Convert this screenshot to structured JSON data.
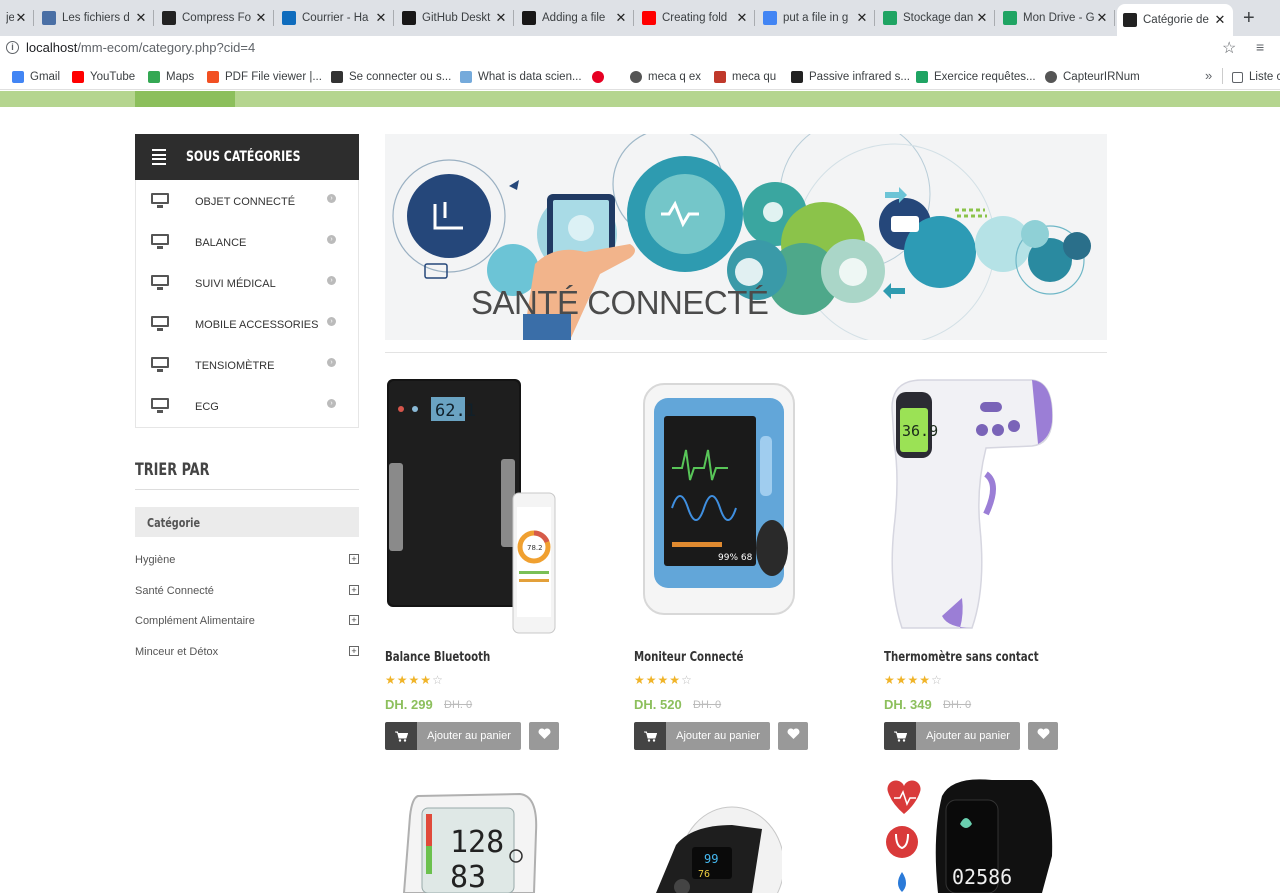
{
  "browser": {
    "tabs": [
      {
        "label": "je",
        "icon": "page-icon",
        "color": "#5f6368"
      },
      {
        "label": "Les fichiers d",
        "icon": "folder-icon",
        "color": "#4a6fa5"
      },
      {
        "label": "Compress Fo",
        "icon": "compress-icon",
        "color": "#222222"
      },
      {
        "label": "Courrier - Ha",
        "icon": "outlook-icon",
        "color": "#0f6cbd"
      },
      {
        "label": "GitHub Deskt",
        "icon": "github-icon",
        "color": "#181717"
      },
      {
        "label": "Adding a file",
        "icon": "github-icon",
        "color": "#181717"
      },
      {
        "label": "Creating fold",
        "icon": "youtube-icon",
        "color": "#ff0000"
      },
      {
        "label": "put a file in g",
        "icon": "google-icon",
        "color": "#4285f4"
      },
      {
        "label": "Stockage dan",
        "icon": "drive-icon",
        "color": "#1fa463"
      },
      {
        "label": "Mon Drive - G",
        "icon": "drive-icon",
        "color": "#1fa463"
      },
      {
        "label": "Catégorie de",
        "icon": "site-icon",
        "color": "#222222"
      }
    ],
    "url_host": "localhost",
    "url_path": "/mm-ecom/category.php?cid=4",
    "bookmarks": [
      {
        "label": "Gmail",
        "icon": "google-icon"
      },
      {
        "label": "YouTube",
        "icon": "youtube-icon"
      },
      {
        "label": "Maps",
        "icon": "maps-icon"
      },
      {
        "label": "PDF File viewer |...",
        "icon": "microsoft-icon"
      },
      {
        "label": "Se connecter ou s...",
        "icon": "bookmark-icon"
      },
      {
        "label": "What is data scien...",
        "icon": "rstudio-icon"
      },
      {
        "label": "",
        "icon": "pinterest-icon"
      },
      {
        "label": "meca q ex",
        "icon": "globe-icon"
      },
      {
        "label": "meca qu",
        "icon": "function-icon"
      },
      {
        "label": "Passive infrared s...",
        "icon": "wikipedia-icon"
      },
      {
        "label": "Exercice requêtes...",
        "icon": "classroom-icon"
      },
      {
        "label": "CapteurIRNum",
        "icon": "globe-icon"
      }
    ],
    "bookmarks_more": "»",
    "reading_list": "Liste c"
  },
  "sidebar": {
    "title": "SOUS CATÉGORIES",
    "items": [
      {
        "label": "OBJET CONNECTÉ"
      },
      {
        "label": "BALANCE"
      },
      {
        "label": "SUIVI MÉDICAL"
      },
      {
        "label": "MOBILE ACCESSORIES"
      },
      {
        "label": "TENSIOMÈTRE"
      },
      {
        "label": "ECG"
      }
    ],
    "sort_title": "TRIER PAR",
    "category_header": "Catégorie",
    "filters": [
      {
        "label": "Hygiène"
      },
      {
        "label": "Santé Connecté"
      },
      {
        "label": "Complément Alimentaire"
      },
      {
        "label": "Minceur et Détox"
      }
    ]
  },
  "banner": {
    "title": "SANTÉ CONNECTÉ"
  },
  "products": [
    {
      "name": "Balance Bluetooth",
      "rating": 4,
      "max_rating": 5,
      "price": "DH. 299",
      "old_price": "DH. 0",
      "cart_label": "Ajouter au panier",
      "image": "smart-scale"
    },
    {
      "name": "Moniteur Connecté",
      "rating": 4,
      "max_rating": 5,
      "price": "DH. 520",
      "old_price": "DH. 0",
      "cart_label": "Ajouter au panier",
      "image": "ecg-monitor"
    },
    {
      "name": "Thermomètre sans contact",
      "rating": 4,
      "max_rating": 5,
      "price": "DH. 349",
      "old_price": "DH. 0",
      "cart_label": "Ajouter au panier",
      "image": "infrared-thermometer"
    }
  ],
  "next_row_images": [
    "blood-pressure-monitor",
    "pulse-oximeter",
    "fitness-band"
  ],
  "colors": {
    "accent": "#8cbf5c",
    "green_bar": "#b5d58f",
    "sidebar_head": "#2d2d2d"
  }
}
